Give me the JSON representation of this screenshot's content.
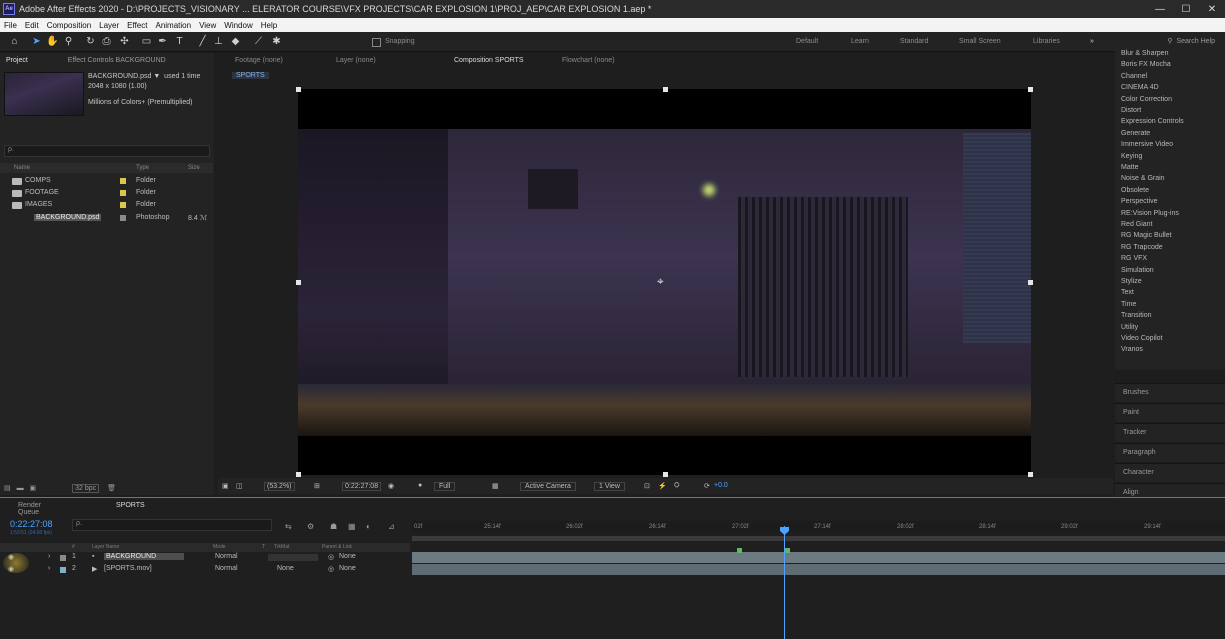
{
  "app": {
    "icon_text": "Ae",
    "window_title": "Adobe After Effects 2020 - D:\\PROJECTS_VISIONARY ... ELERATOR COURSE\\VFX PROJECTS\\CAR EXPLOSION 1\\PROJ_AEP\\CAR EXPLOSION 1.aep *",
    "controls": [
      "—",
      "☐",
      "✕"
    ]
  },
  "menu": [
    "File",
    "Edit",
    "Composition",
    "Layer",
    "Effect",
    "Animation",
    "View",
    "Window",
    "Help"
  ],
  "toolbar": {
    "snapping_label": "Snapping",
    "workspaces": [
      "Default",
      "Learn",
      "Standard",
      "Small Screen",
      "Libraries"
    ],
    "overflow": "»",
    "search_placeholder": "Search Help"
  },
  "project_panel": {
    "tabs": [
      "Project",
      "Effect Controls BACKGROUND"
    ],
    "selected_item": "BACKGROUND.psd ▼",
    "used_count": "used 1 time",
    "dimensions": "2048 x 1080 (1.00)",
    "color_info": "Millions of Colors+ (Premultiplied)",
    "search_placeholder": "ρ.",
    "columns": [
      "Name",
      "Type",
      "Size"
    ],
    "items": [
      {
        "name": "COMPS",
        "type": "Folder",
        "size": ""
      },
      {
        "name": "FOOTAGE",
        "type": "Folder",
        "size": ""
      },
      {
        "name": "IMAGES",
        "type": "Folder",
        "size": ""
      },
      {
        "name": "BACKGROUND.psd",
        "type": "Photoshop",
        "size": "8.4 ℳ"
      }
    ],
    "bit_depth": "32 bpc"
  },
  "viewer": {
    "tabs": [
      "Footage (none)",
      "Layer (none)",
      "Composition SPORTS",
      "Flowchart (none)"
    ],
    "comp_chip": "SPORTS",
    "zoom": "(53.2%)",
    "timecode": "0:22:27:08",
    "resolution": "Full",
    "camera": "Active Camera",
    "view": "1 View",
    "exposure": "+0.0"
  },
  "effects_panel": {
    "items": [
      "Blur & Sharpen",
      "Boris FX Mocha",
      "Channel",
      "CINEMA 4D",
      "Color Correction",
      "Distort",
      "Expression Controls",
      "Generate",
      "Immersive Video",
      "Keying",
      "Matte",
      "Noise & Grain",
      "Obsolete",
      "Perspective",
      "RE:Vision Plug-ins",
      "Red Giant",
      "RG Magic Bullet",
      "RG Trapcode",
      "RG VFX",
      "Simulation",
      "Stylize",
      "Text",
      "Time",
      "Transition",
      "Utility",
      "Video Copilot",
      "Vranos"
    ],
    "extra_panels": [
      "Brushes",
      "Paint",
      "Tracker",
      "Paragraph",
      "Character",
      "Align"
    ]
  },
  "timeline": {
    "tabs": [
      "Render Queue",
      "SPORTS"
    ],
    "timecode": "0:22:27:08",
    "fps": "1:53:51 (24.00 fps)",
    "search_placeholder": "ρ.",
    "columns": [
      "#",
      "Layer Name",
      "Mode",
      "T",
      "TrkMat",
      "Parent & Link"
    ],
    "layers": [
      {
        "num": "1",
        "name": "BACKGROUND",
        "mode": "Normal",
        "trkmat": "",
        "parent": "None"
      },
      {
        "num": "2",
        "name": "[SPORTS.mov]",
        "mode": "Normal",
        "trkmat": "None",
        "parent": "None"
      }
    ],
    "ruler": [
      "02f",
      "25:14f",
      "26:02f",
      "26:14f",
      "27:02f",
      "27:14f",
      "28:02f",
      "28:14f",
      "29:02f",
      "29:14f"
    ]
  }
}
